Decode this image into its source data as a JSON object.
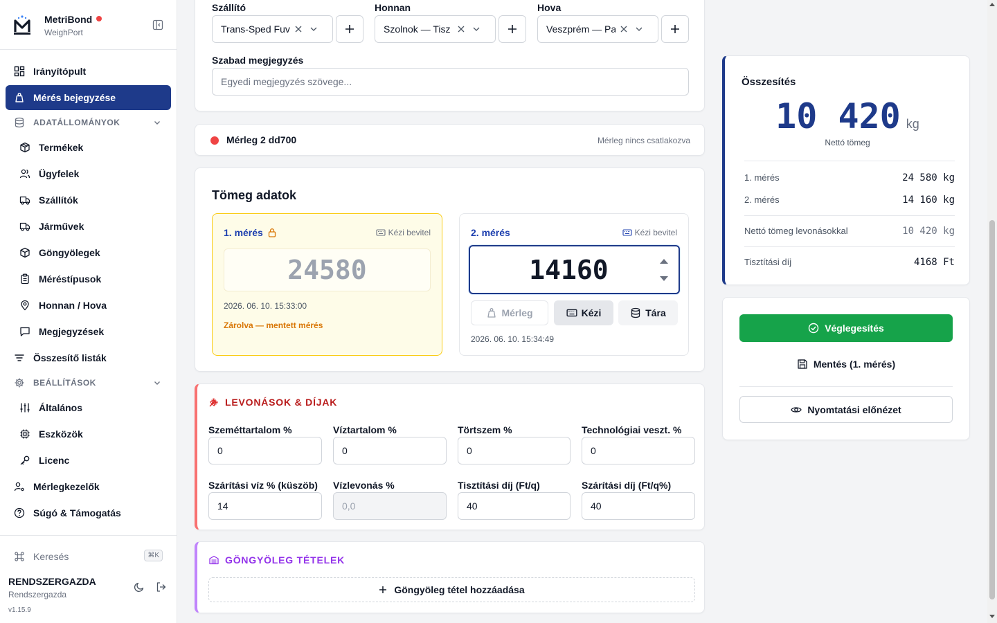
{
  "brand": {
    "name": "MetriBond",
    "subtitle": "WeighPort"
  },
  "sidebar": {
    "items": [
      {
        "label": "Irányítópult"
      },
      {
        "label": "Mérés bejegyzése"
      },
      {
        "label": "ADATÁLLOMÁNYOK"
      },
      {
        "label": "Termékek"
      },
      {
        "label": "Ügyfelek"
      },
      {
        "label": "Szállítók"
      },
      {
        "label": "Járművek"
      },
      {
        "label": "Göngyölegek"
      },
      {
        "label": "Méréstípusok"
      },
      {
        "label": "Honnan / Hova"
      },
      {
        "label": "Megjegyzések"
      },
      {
        "label": "Összesítő listák"
      },
      {
        "label": "BEÁLLÍTÁSOK"
      },
      {
        "label": "Általános"
      },
      {
        "label": "Eszközök"
      },
      {
        "label": "Licenc"
      },
      {
        "label": "Mérlegkezelők"
      },
      {
        "label": "Súgó & Támogatás"
      }
    ],
    "search_label": "Keresés",
    "search_shortcut": "⌘K",
    "user_name": "RENDSZERGAZDA",
    "user_role": "Rendszergazda",
    "version": "v1.15.9"
  },
  "form": {
    "supplier_label": "Szállító",
    "supplier_value": "Trans-Sped Fuv",
    "from_label": "Honnan",
    "from_value": "Szolnok — Tisz",
    "to_label": "Hova",
    "to_value": "Veszprém — Pa",
    "note_label": "Szabad megjegyzés",
    "note_placeholder": "Egyedi megjegyzés szövege..."
  },
  "scale": {
    "name": "Mérleg 2 dd700",
    "status": "Mérleg nincs csatlakozva",
    "status_color": "#ef4444"
  },
  "weights": {
    "title": "Tömeg adatok",
    "first": {
      "label": "1. mérés",
      "manual": "Kézi bevitel",
      "value": "24580",
      "timestamp": "2026. 06. 10. 15:33:00",
      "locked_text": "Zárolva — mentett mérés"
    },
    "second": {
      "label": "2. mérés",
      "manual": "Kézi bevitel",
      "value": "14160",
      "btn_scale": "Mérleg",
      "btn_manual": "Kézi",
      "btn_tare": "Tára",
      "timestamp": "2026. 06. 10. 15:34:49"
    }
  },
  "deductions": {
    "title": "LEVONÁSOK & DÍJAK",
    "fields": [
      {
        "label": "Szeméttartalom %",
        "value": "0"
      },
      {
        "label": "Víztartalom %",
        "value": "0"
      },
      {
        "label": "Törtszem %",
        "value": "0"
      },
      {
        "label": "Technológiai veszt. %",
        "value": "0"
      },
      {
        "label": "Szárítási víz % (küszöb)",
        "value": "14"
      },
      {
        "label": "Vízlevonás %",
        "value": "0,0"
      },
      {
        "label": "Tisztítási díj (Ft/q)",
        "value": "40"
      },
      {
        "label": "Szárítási díj (Ft/q%)",
        "value": "40"
      }
    ]
  },
  "packaging": {
    "title": "GÖNGYÖLEG TÉTELEK",
    "add_label": "Göngyöleg tétel hozzáadása"
  },
  "summary": {
    "title": "Összesítés",
    "net_value": "10 420",
    "net_unit": "kg",
    "net_label": "Nettó tömeg",
    "rows": [
      {
        "label": "1. mérés",
        "value": "24 580 kg"
      },
      {
        "label": "2. mérés",
        "value": "14 160 kg"
      },
      {
        "label": "Nettó tömeg levonásokkal",
        "value": "10 420 kg"
      },
      {
        "label": "Tisztítási díj",
        "value": "4168 Ft"
      }
    ]
  },
  "actions": {
    "finalize": "Véglegesítés",
    "save": "Mentés (1. mérés)",
    "preview": "Nyomtatási előnézet"
  },
  "colors": {
    "primary": "#1e3a8a",
    "success": "#16a34a",
    "danger": "#ef4444",
    "purple": "#9333ea",
    "warning": "#d97706"
  }
}
